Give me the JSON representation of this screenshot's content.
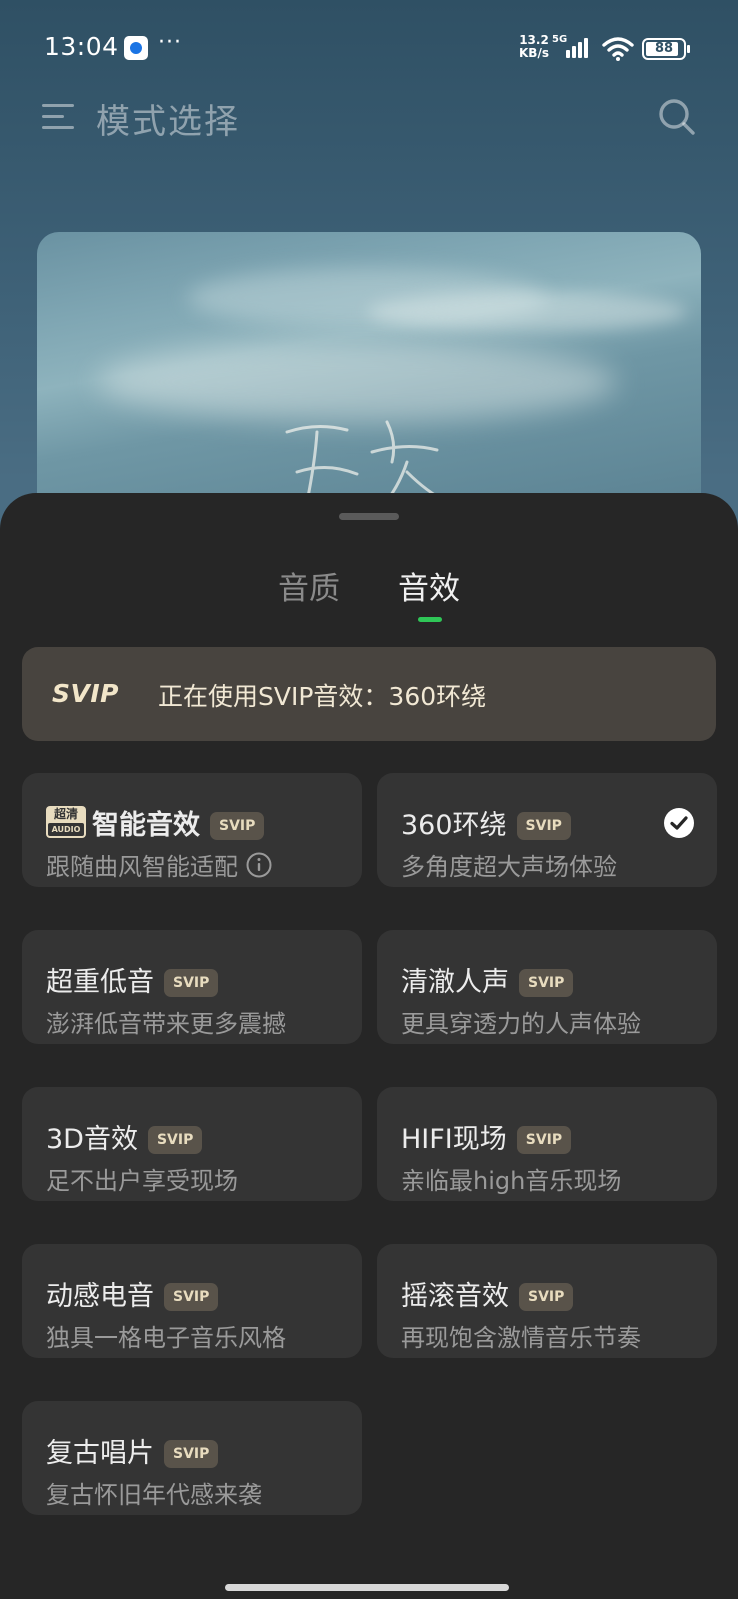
{
  "status_bar": {
    "time": "13:04",
    "network_speed": "13.2",
    "network_speed_unit": "KB/s",
    "network_type": "5G",
    "battery": "88",
    "battery_level": 0.88
  },
  "header": {
    "title": "模式选择"
  },
  "sheet": {
    "tabs": [
      {
        "label": "音质",
        "active": false
      },
      {
        "label": "音效",
        "active": true
      }
    ],
    "banner": {
      "logo": "SVIP",
      "text": "正在使用SVIP音效：360环绕"
    },
    "hd_badge": {
      "top": "超清",
      "bottom": "AUDIO"
    },
    "svip_tag": "SVIP",
    "effects": [
      {
        "title": "智能音效",
        "desc": "跟随曲风智能适配",
        "selected": false
      },
      {
        "title": "360环绕",
        "desc": "多角度超大声场体验",
        "selected": true
      },
      {
        "title": "超重低音",
        "desc": "澎湃低音带来更多震撼",
        "selected": false
      },
      {
        "title": "清澈人声",
        "desc": "更具穿透力的人声体验",
        "selected": false
      },
      {
        "title": "3D音效",
        "desc": "足不出户享受现场",
        "selected": false
      },
      {
        "title": "HIFI现场",
        "desc": "亲临最high音乐现场",
        "selected": false
      },
      {
        "title": "动感电音",
        "desc": "独具一格电子音乐风格",
        "selected": false
      },
      {
        "title": "摇滚音效",
        "desc": "再现饱含激情音乐节奏",
        "selected": false
      },
      {
        "title": "复古唱片",
        "desc": "复古怀旧年代感来袭",
        "selected": false
      }
    ]
  },
  "colors": {
    "accent": "#2fc657",
    "sheet_bg": "#262626",
    "card_bg": "#343434",
    "svip_gold": "#e8dcbf"
  }
}
